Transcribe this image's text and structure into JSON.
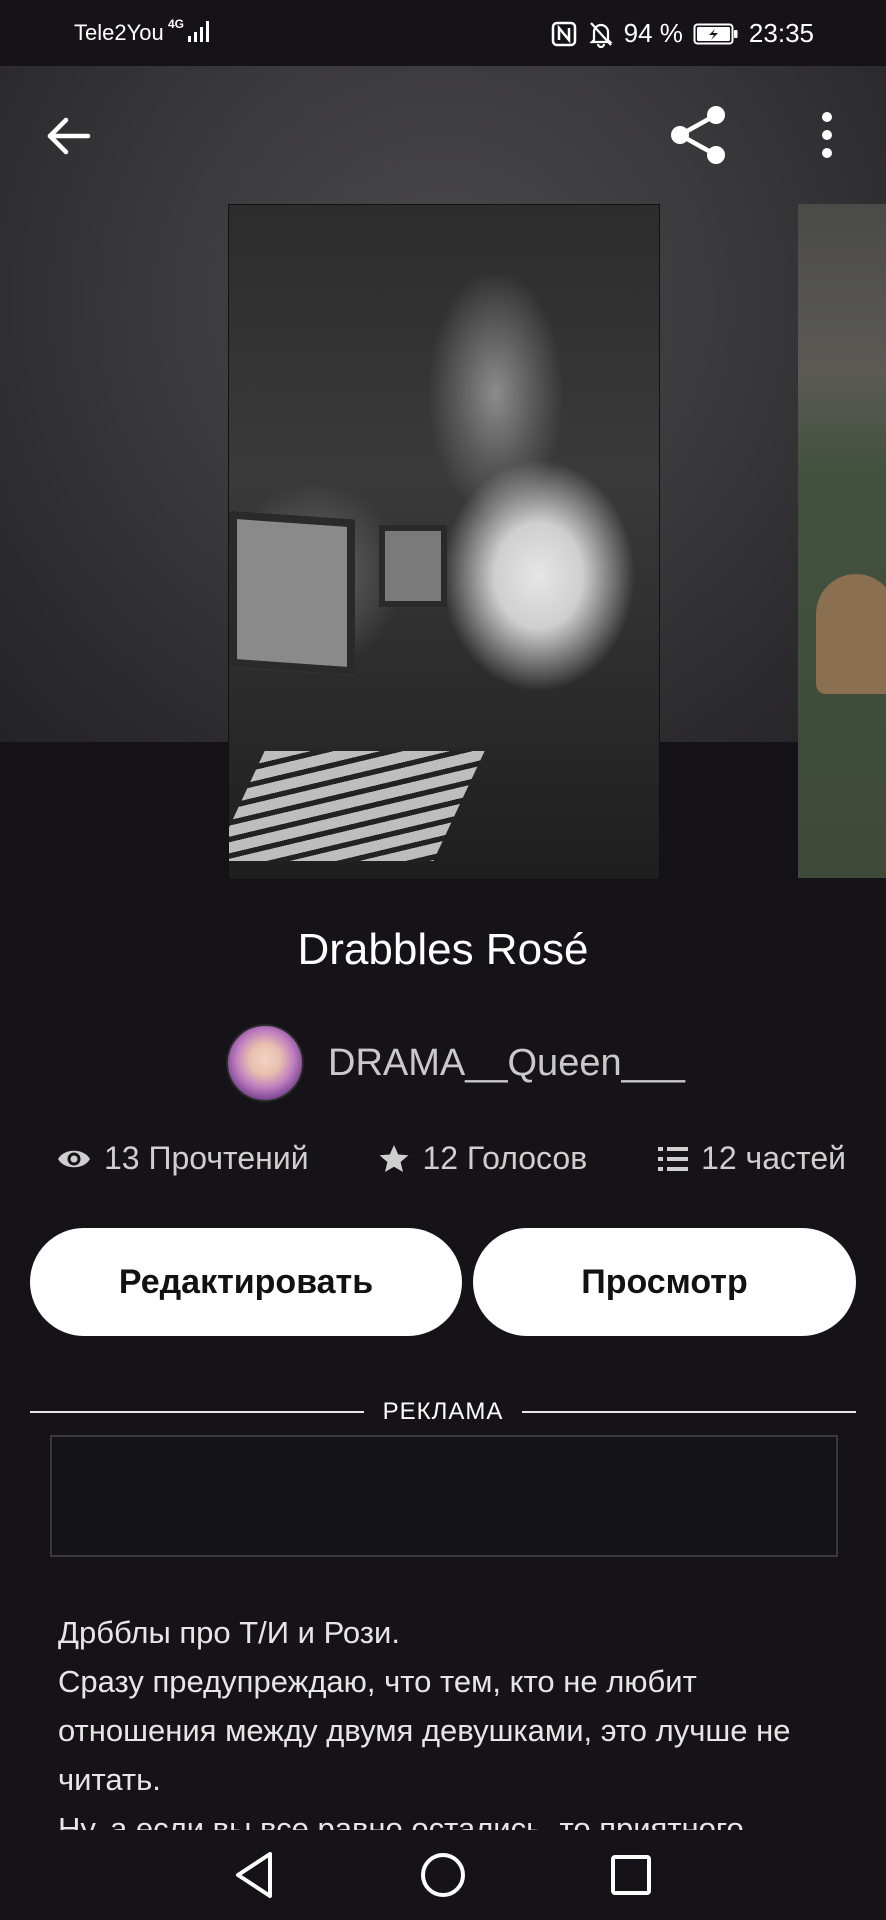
{
  "status_bar": {
    "carrier": "Tele2You",
    "network": "4G",
    "battery_percent": "94 %",
    "time": "23:35"
  },
  "book": {
    "title": "Drabbles Rosé",
    "author": "DRAMA__Queen___",
    "reads": "13 Прочтений",
    "votes": "12 Голосов",
    "parts": "12 частей"
  },
  "actions": {
    "edit_label": "Редактировать",
    "preview_label": "Просмотр"
  },
  "ad": {
    "label": "РЕКЛАМА"
  },
  "description": {
    "lines": [
      "Дрбблы про Т/И и Рози.",
      "Сразу предупреждаю, что тем, кто не любит отношения между двумя девушками, это лучше не читать.",
      "Ну, а если вы все равно остались, то приятного"
    ]
  },
  "icons": {
    "back": "arrow-left-icon",
    "share": "share-icon",
    "more": "more-vertical-icon",
    "reads": "eye-icon",
    "votes": "star-icon",
    "parts": "list-icon",
    "nav_back": "triangle-back-icon",
    "nav_home": "circle-home-icon",
    "nav_recents": "square-recents-icon"
  },
  "colors": {
    "background": "#151317",
    "button_bg": "#ffffff",
    "button_text": "#121212",
    "muted_text": "#cfcfcf"
  }
}
